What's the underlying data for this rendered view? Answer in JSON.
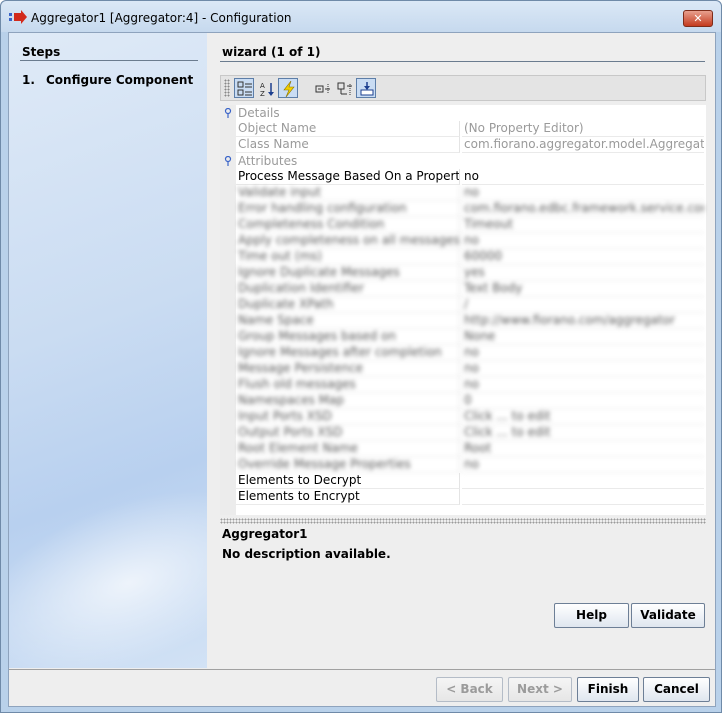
{
  "window": {
    "title": "Aggregator1 [Aggregator:4] - Configuration",
    "close_label": "✕"
  },
  "steps": {
    "title": "Steps",
    "items": [
      {
        "number": "1.",
        "label": "Configure Component"
      }
    ]
  },
  "wizard": {
    "title": "wizard (1 of 1)"
  },
  "toolbar": {
    "buttons": [
      {
        "name": "categorized-view-icon",
        "active": true
      },
      {
        "name": "sort-alphabetical-icon",
        "active": false
      },
      {
        "name": "lightning-icon",
        "active": true
      },
      {
        "name": "expand-all-icon",
        "active": false
      },
      {
        "name": "collapse-all-icon",
        "active": false
      },
      {
        "name": "description-toggle-icon",
        "active": true
      }
    ]
  },
  "properties": {
    "details_label": "Details",
    "details": [
      {
        "name": "Object Name",
        "value": "(No Property Editor)"
      },
      {
        "name": "Class Name",
        "value": "com.fiorano.aggregator.model.Aggregator..."
      }
    ],
    "attributes_label": "Attributes",
    "attributes": [
      {
        "name": "Process Message Based On a Property",
        "value": "no",
        "blurred": false
      },
      {
        "name": "Validate input",
        "value": "no",
        "blurred": true
      },
      {
        "name": "Error handling configuration",
        "value": "com.fiorano.edbc.framework.service.confi...",
        "blurred": true
      },
      {
        "name": "Completeness Condition",
        "value": "Timeout",
        "blurred": true
      },
      {
        "name": "Apply completeness on all messages?",
        "value": "no",
        "blurred": true
      },
      {
        "name": "Time out (ms)",
        "value": "60000",
        "blurred": true
      },
      {
        "name": "Ignore Duplicate Messages",
        "value": "yes",
        "blurred": true
      },
      {
        "name": "Duplication Identifier",
        "value": "Text Body",
        "blurred": true
      },
      {
        "name": "Duplicate XPath",
        "value": "/",
        "blurred": true
      },
      {
        "name": "Name Space",
        "value": "http://www.fiorano.com/aggregator",
        "blurred": true
      },
      {
        "name": "Group Messages based on",
        "value": "None",
        "blurred": true
      },
      {
        "name": "Ignore Messages after completion",
        "value": "no",
        "blurred": true
      },
      {
        "name": "Message Persistence",
        "value": "no",
        "blurred": true
      },
      {
        "name": "Flush old messages",
        "value": "no",
        "blurred": true
      },
      {
        "name": "Namespaces Map",
        "value": "0",
        "blurred": true
      },
      {
        "name": "Input Ports XSD",
        "value": "Click ... to edit",
        "blurred": true
      },
      {
        "name": "Output Ports XSD",
        "value": "Click ... to edit",
        "blurred": true
      },
      {
        "name": "Root Element Name",
        "value": "Root",
        "blurred": true
      },
      {
        "name": "Override Message Properties",
        "value": "no",
        "blurred": true
      },
      {
        "name": "Elements to Decrypt",
        "value": "",
        "blurred": false
      },
      {
        "name": "Elements to Encrypt",
        "value": "",
        "blurred": false
      }
    ]
  },
  "description": {
    "title": "Aggregator1",
    "text": "No description available."
  },
  "actions": {
    "help": "Help",
    "validate": "Validate"
  },
  "footer": {
    "back": "< Back",
    "next": "Next >",
    "finish": "Finish",
    "cancel": "Cancel"
  }
}
